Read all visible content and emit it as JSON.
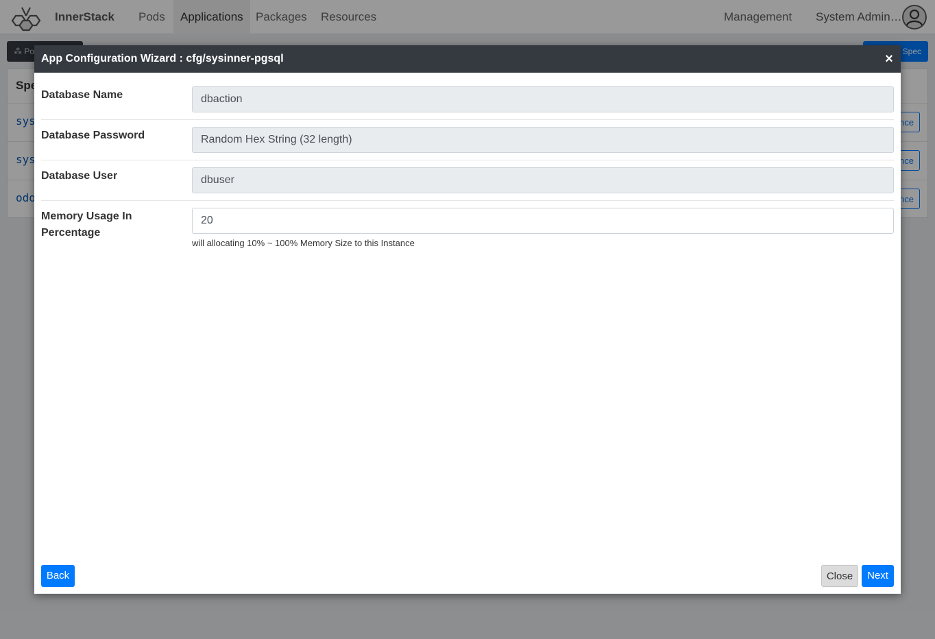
{
  "navbar": {
    "brand": "InnerStack",
    "items": [
      {
        "label": "Pods"
      },
      {
        "label": "Applications"
      },
      {
        "label": "Packages"
      },
      {
        "label": "Resources"
      }
    ],
    "management": "Management",
    "user": "System Admin…",
    "logo_icon": "hexagon-cluster-logo",
    "avatar_icon": "user-avatar-icon"
  },
  "background": {
    "toolbar_left_label": "Po",
    "toolbar_left_icon": "pod-icon",
    "toolbar_right_label": "Spec",
    "panel_header": "Spe",
    "rows": [
      {
        "name": "sys",
        "action": "nce"
      },
      {
        "name": "sys",
        "action": "nce"
      },
      {
        "name": "odo",
        "action": "nce"
      }
    ]
  },
  "modal": {
    "title": "App Configuration Wizard : cfg/sysinner-pgsql",
    "close_icon": "×",
    "fields": [
      {
        "label": "Database Name",
        "value": "dbaction"
      },
      {
        "label": "Database Password",
        "value": "Random Hex String (32 length)"
      },
      {
        "label": "Database User",
        "value": "dbuser"
      },
      {
        "label": "Memory Usage In Percentage",
        "value": "20",
        "help": "will allocating 10% ~ 100% Memory Size to this Instance"
      }
    ],
    "buttons": {
      "back": "Back",
      "close": "Close",
      "next": "Next"
    }
  },
  "colors": {
    "primary": "#007bff",
    "header_dark": "#343a40",
    "readonly_bg": "#e9ecef"
  }
}
